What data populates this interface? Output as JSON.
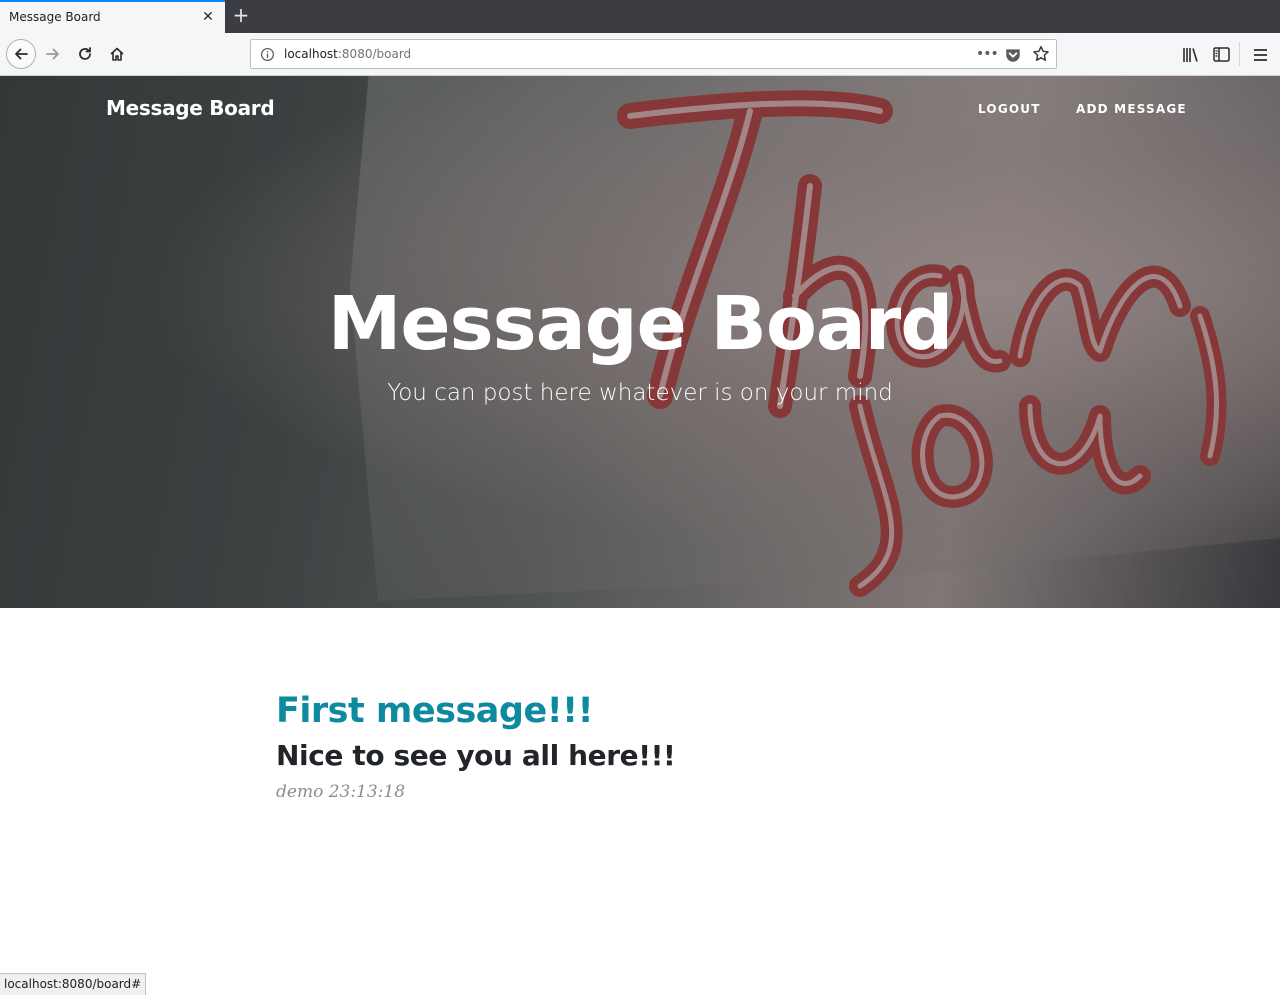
{
  "browser": {
    "tab_title": "Message Board",
    "tab_close": "✕",
    "new_tab": "+",
    "url_host": "localhost",
    "url_rest": ":8080/board",
    "url_more": "•••",
    "status_url": "localhost:8080/board#"
  },
  "site": {
    "brand": "Message Board",
    "nav": [
      {
        "label": "Logout"
      },
      {
        "label": "Add Message"
      }
    ],
    "hero_title": "Message Board",
    "hero_subtitle": "You can post here whatever is on your mind"
  },
  "messages": [
    {
      "title": "First message!!!",
      "body": "Nice to see you all here!!!",
      "meta": "demo 23:13:18"
    }
  ],
  "colors": {
    "accent": "#0e8aa0",
    "text": "#212529",
    "muted": "#868e96"
  }
}
